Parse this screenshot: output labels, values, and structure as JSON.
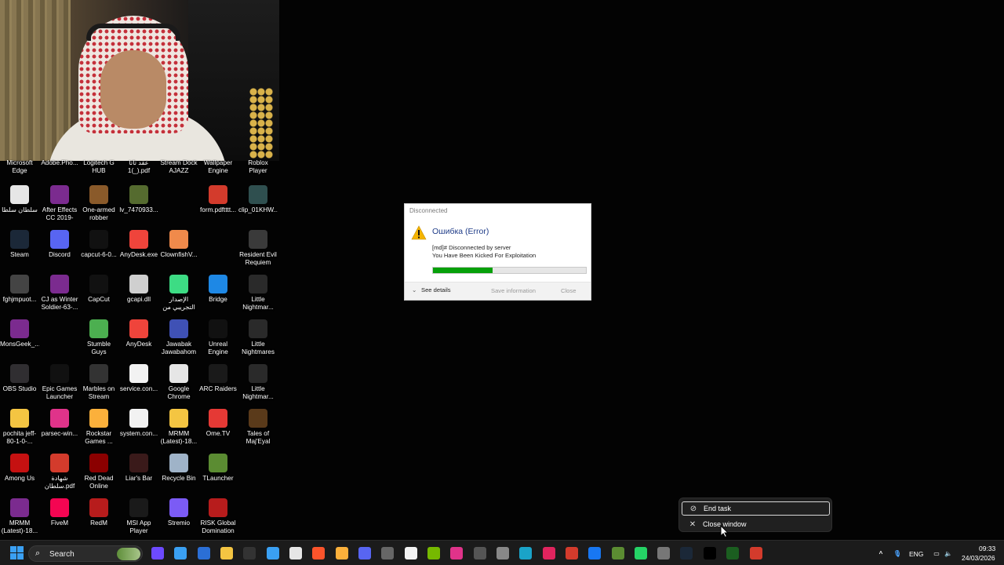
{
  "desktop": {
    "top_row_labels": [
      "Microsoft Edge",
      "Adobe.Pho...",
      "Logitech G HUB",
      "عقد تأتا 1(_).pdf",
      "Stream Dock AJAZZ",
      "Wallpaper Engine",
      "Roblox Player"
    ],
    "icons": [
      {
        "label": "سلطان سلطا",
        "icon": "chrome-user-icon",
        "color": "#e6e6e6"
      },
      {
        "label": "After Effects CC 2019-20...",
        "icon": "winrar-icon",
        "color": "#7b2b8f"
      },
      {
        "label": "One-armed robber",
        "icon": "game-icon",
        "color": "#8a5a2a"
      },
      {
        "label": "lv_7470933...",
        "icon": "video-icon",
        "color": "#556b2f"
      },
      {
        "label": "form.pdftttt...",
        "icon": "pdf-icon",
        "color": "#d33b2c"
      },
      {
        "label": "clip_01KHW...",
        "icon": "video-icon",
        "color": "#2f4f4f"
      },
      {
        "label": "Steam",
        "icon": "steam-icon",
        "color": "#1b2838"
      },
      {
        "label": "Discord",
        "icon": "discord-icon",
        "color": "#5865f2"
      },
      {
        "label": "capcut-6-0...",
        "icon": "capcut-icon",
        "color": "#111111"
      },
      {
        "label": "AnyDesk.exe",
        "icon": "anydesk-icon",
        "color": "#ef443b"
      },
      {
        "label": "ClownfishV...",
        "icon": "clownfish-icon",
        "color": "#f08a4b"
      },
      {
        "label": "Resident Evil Requiem",
        "icon": "game-icon",
        "color": "#3a3a3a"
      },
      {
        "label": "fghjmpuot...",
        "icon": "file-icon",
        "color": "#444444"
      },
      {
        "label": "CJ as Winter Soldier-63-...",
        "icon": "winrar-icon",
        "color": "#7b2b8f"
      },
      {
        "label": "CapCut",
        "icon": "capcut-icon",
        "color": "#111111"
      },
      {
        "label": "gcapi.dll",
        "icon": "dll-icon",
        "color": "#cfcfcf"
      },
      {
        "label": "الإصدار التجريبي من",
        "icon": "android-icon",
        "color": "#3ddc84"
      },
      {
        "label": "Bridge",
        "icon": "bridge-icon",
        "color": "#1e88e5"
      },
      {
        "label": "Little Nightmar...",
        "icon": "game-icon",
        "color": "#2a2a2a"
      },
      {
        "label": "MonsGeek_...",
        "icon": "winrar-icon",
        "color": "#7b2b8f"
      },
      {
        "label": "Stumble Guys",
        "icon": "game-icon",
        "color": "#4caf50"
      },
      {
        "label": "AnyDesk",
        "icon": "anydesk-icon",
        "color": "#ef443b"
      },
      {
        "label": "Jawabak Jawabahom",
        "icon": "game-icon",
        "color": "#3f51b5"
      },
      {
        "label": "Unreal Engine",
        "icon": "unreal-icon",
        "color": "#111111"
      },
      {
        "label": "Little Nightmares",
        "icon": "game-icon",
        "color": "#2a2a2a"
      },
      {
        "label": "OBS Studio",
        "icon": "obs-icon",
        "color": "#302e31"
      },
      {
        "label": "Epic Games Launcher",
        "icon": "epic-icon",
        "color": "#111111"
      },
      {
        "label": "Marbles on Stream",
        "icon": "game-icon",
        "color": "#333333"
      },
      {
        "label": "service.con...",
        "icon": "file-icon",
        "color": "#f2f2f2"
      },
      {
        "label": "Google Chrome",
        "icon": "chrome-icon",
        "color": "#e6e6e6"
      },
      {
        "label": "ARC Raiders",
        "icon": "game-icon",
        "color": "#1a1a1a"
      },
      {
        "label": "Little Nightmar...",
        "icon": "game-icon",
        "color": "#2a2a2a"
      },
      {
        "label": "pochita jeff-80-1-0-...",
        "icon": "folder-icon",
        "color": "#f4c542"
      },
      {
        "label": "parsec-win...",
        "icon": "parsec-icon",
        "color": "#e0338a"
      },
      {
        "label": "Rockstar Games ...",
        "icon": "rockstar-icon",
        "color": "#fbb03b"
      },
      {
        "label": "system.con...",
        "icon": "file-icon",
        "color": "#f2f2f2"
      },
      {
        "label": "MRMM (Latest)-18...",
        "icon": "folder-icon",
        "color": "#f4c542"
      },
      {
        "label": "Ome.TV",
        "icon": "ometv-icon",
        "color": "#e53935"
      },
      {
        "label": "Tales of Maj'Eyal",
        "icon": "game-icon",
        "color": "#5a3a1a"
      },
      {
        "label": "Among Us",
        "icon": "amongus-icon",
        "color": "#c51111"
      },
      {
        "label": "شهادة سلطان.pdf",
        "icon": "pdf-icon",
        "color": "#d33b2c"
      },
      {
        "label": "Red Dead Online",
        "icon": "game-icon",
        "color": "#8b0000"
      },
      {
        "label": "Liar's Bar",
        "icon": "game-icon",
        "color": "#3a1a1a"
      },
      {
        "label": "Recycle Bin",
        "icon": "recycle-bin-icon",
        "color": "#9fb3c8"
      },
      {
        "label": "TLauncher",
        "icon": "minecraft-icon",
        "color": "#5b8c32"
      },
      {
        "label": "MRMM (Latest)-18...",
        "icon": "winrar-icon",
        "color": "#7b2b8f"
      },
      {
        "label": "FiveM",
        "icon": "fivem-icon",
        "color": "#f40552"
      },
      {
        "label": "RedM",
        "icon": "redm-icon",
        "color": "#b71c1c"
      },
      {
        "label": "MSI App Player",
        "icon": "msi-icon",
        "color": "#1a1a1a"
      },
      {
        "label": "Stremio",
        "icon": "stremio-icon",
        "color": "#7b5bf5"
      },
      {
        "label": "RISK Global Domination",
        "icon": "risk-icon",
        "color": "#b71c1c"
      }
    ]
  },
  "dialog": {
    "title": "Disconnected",
    "heading": "Ошибка (Error)",
    "message_line1": "[md]# Disconnected by server",
    "message_line2": "You Have Been Kicked For Exploitation",
    "progress": 0.39,
    "details_label": "See details",
    "save_label": "Save information",
    "close_label": "Close",
    "accent": "#06a00a"
  },
  "jump_menu": {
    "end_task": "End task",
    "close_window": "Close window"
  },
  "taskbar": {
    "search_label": "Search",
    "language": "ENG",
    "time": "09:33",
    "date": "24/03/2026"
  }
}
